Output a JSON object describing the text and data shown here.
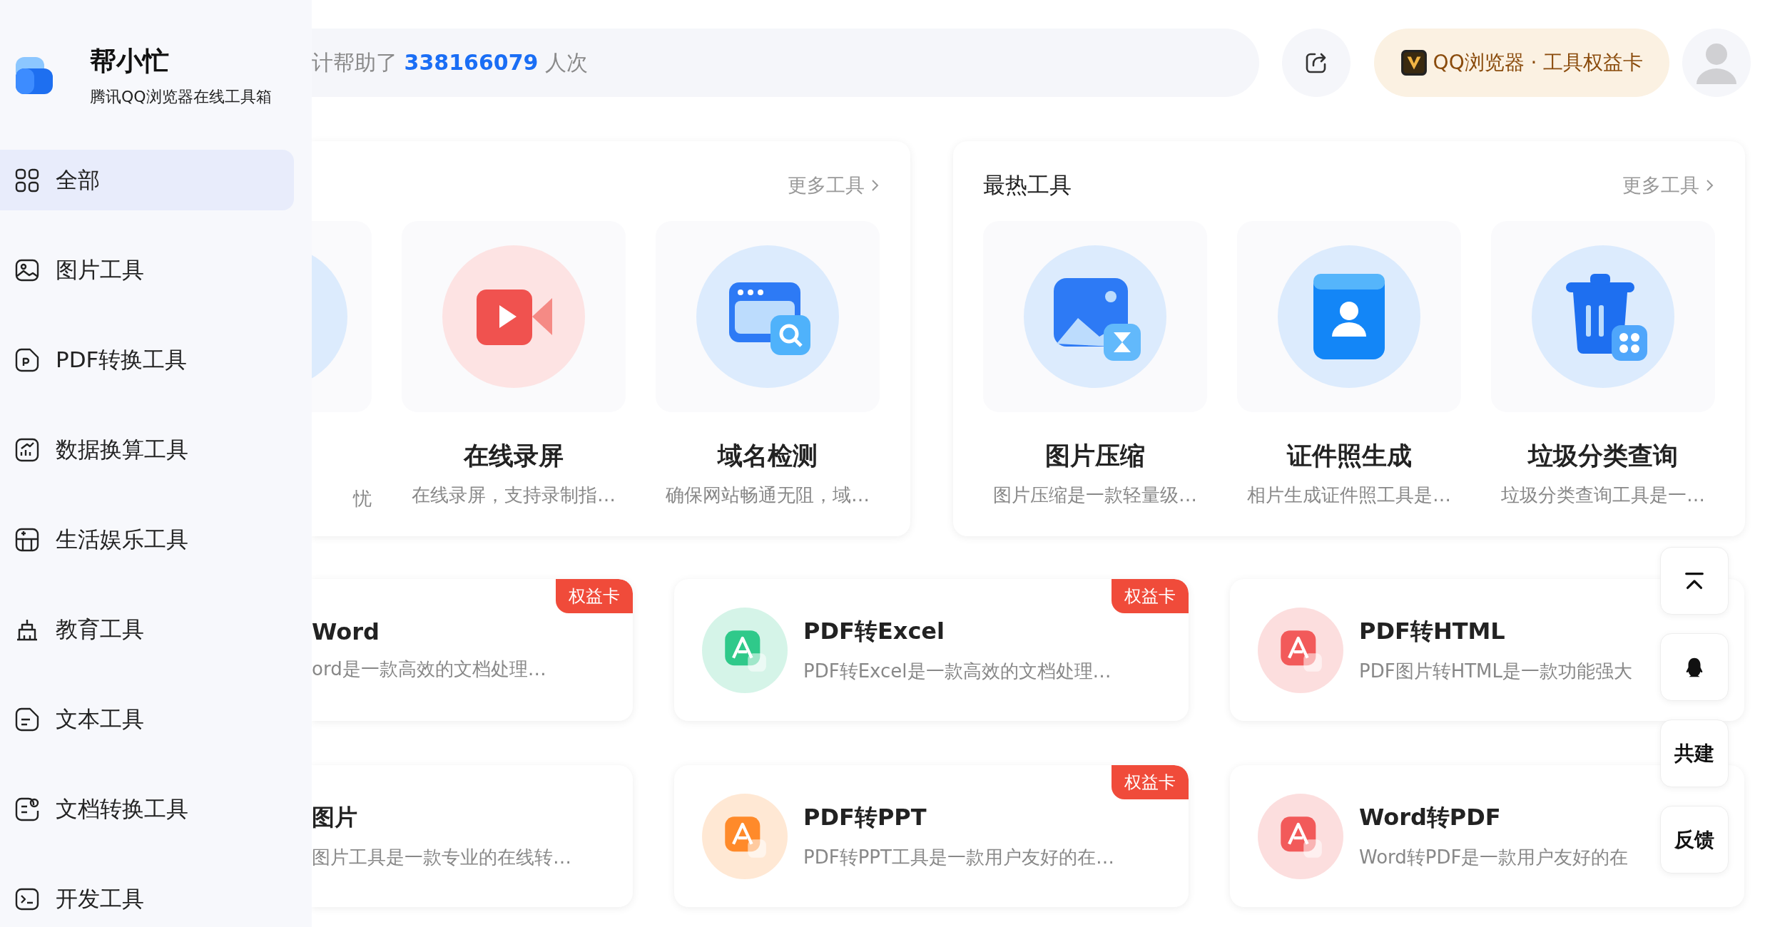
{
  "sidebar": {
    "logo_title": "帮小忙",
    "logo_subtitle": "腾讯QQ浏览器在线工具箱",
    "items": [
      {
        "label": "全部",
        "selected": true
      },
      {
        "label": "图片工具",
        "selected": false
      },
      {
        "label": "PDF转换工具",
        "selected": false
      },
      {
        "label": "数据换算工具",
        "selected": false
      },
      {
        "label": "生活娱乐工具",
        "selected": false
      },
      {
        "label": "教育工具",
        "selected": false
      },
      {
        "label": "文本工具",
        "selected": false
      },
      {
        "label": "文档转换工具",
        "selected": false
      },
      {
        "label": "开发工具",
        "selected": false
      }
    ]
  },
  "topbar": {
    "stats_prefix": "计帮助了",
    "stats_count": "338166079",
    "stats_suffix": "人次",
    "vip_label": "QQ浏览器 · 工具权益卡"
  },
  "featured_card": {
    "more_link": "更多工具",
    "tiles": [
      {
        "desc": "忧"
      },
      {
        "name": "在线录屏",
        "desc": "在线录屏，支持录制指…"
      },
      {
        "name": "域名检测",
        "desc": "确保网站畅通无阻，域…"
      }
    ]
  },
  "hot_card": {
    "title": "最热工具",
    "more_link": "更多工具",
    "tiles": [
      {
        "name": "图片压缩",
        "desc": "图片压缩是一款轻量级…"
      },
      {
        "name": "证件照生成",
        "desc": "相片生成证件照工具是…"
      },
      {
        "name": "垃圾分类查询",
        "desc": "垃圾分类查询工具是一…"
      }
    ]
  },
  "tool_rows": [
    [
      {
        "title": "Word",
        "desc": "ord是一款高效的文档处理…",
        "badge": "权益卡"
      },
      {
        "title": "PDF转Excel",
        "desc": "PDF转Excel是一款高效的文档处理…",
        "badge": "权益卡",
        "color": "#2fc98a"
      },
      {
        "title": "PDF转HTML",
        "desc": "PDF图片转HTML是一款功能强大",
        "color": "#f25a5a"
      }
    ],
    [
      {
        "title": "图片",
        "desc": "图片工具是一款专业的在线转…"
      },
      {
        "title": "PDF转PPT",
        "desc": "PDF转PPT工具是一款用户友好的在…",
        "badge": "权益卡",
        "color": "#ff8a2a"
      },
      {
        "title": "Word转PDF",
        "desc": "Word转PDF是一款用户友好的在",
        "color": "#f25a5a"
      }
    ]
  ],
  "float_buttons": [
    {
      "kind": "top"
    },
    {
      "kind": "qq"
    },
    {
      "kind": "text",
      "label": "共建"
    },
    {
      "kind": "text",
      "label": "反馈"
    }
  ]
}
